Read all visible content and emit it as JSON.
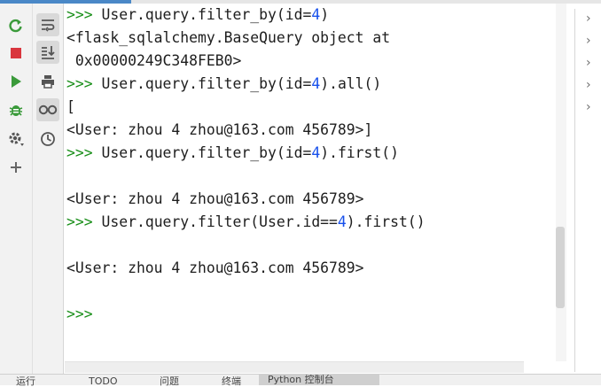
{
  "console": {
    "lines": [
      {
        "prompt": ">>> ",
        "pre": "User.query.filter_by(id=",
        "num": "4",
        "post": ")"
      },
      {
        "prompt": "",
        "pre": "<flask_sqlalchemy.BaseQuery object at",
        "num": "",
        "post": ""
      },
      {
        "prompt": "",
        "pre": " 0x00000249C348FEB0>",
        "num": "",
        "post": ""
      },
      {
        "prompt": ">>> ",
        "pre": "User.query.filter_by(id=",
        "num": "4",
        "post": ").all()"
      },
      {
        "prompt": "",
        "pre": "[",
        "num": "",
        "post": ""
      },
      {
        "prompt": "",
        "pre": "<User: zhou 4 zhou@163.com 456789>]",
        "num": "",
        "post": ""
      },
      {
        "prompt": ">>> ",
        "pre": "User.query.filter_by(id=",
        "num": "4",
        "post": ").first()"
      },
      {
        "prompt": "",
        "pre": "",
        "num": "",
        "post": ""
      },
      {
        "prompt": "",
        "pre": "<User: zhou 4 zhou@163.com 456789>",
        "num": "",
        "post": ""
      },
      {
        "prompt": ">>> ",
        "pre": "User.query.filter(User.id==",
        "num": "4",
        "post": ").first()"
      },
      {
        "prompt": "",
        "pre": "",
        "num": "",
        "post": ""
      },
      {
        "prompt": "",
        "pre": "<User: zhou 4 zhou@163.com 456789>",
        "num": "",
        "post": ""
      },
      {
        "prompt": "",
        "pre": "",
        "num": "",
        "post": ""
      },
      {
        "prompt": ">>>",
        "pre": "",
        "num": "",
        "post": ""
      }
    ]
  },
  "bottom_tabs": [
    "运行",
    "TODO",
    "问题",
    "终端",
    "Python 控制台"
  ],
  "colors": {
    "prompt": "#1a8f1a",
    "number": "#1750eb",
    "accent": "#4a88c7"
  },
  "icons": {
    "left_toolbar": [
      "rerun-icon",
      "stop-icon",
      "run-icon",
      "debug-icon",
      "settings-icon",
      "add-icon"
    ],
    "second_toolbar": [
      "soft-wrap-icon",
      "scroll-to-end-icon",
      "print-icon",
      "show-variables-icon",
      "history-icon"
    ]
  }
}
